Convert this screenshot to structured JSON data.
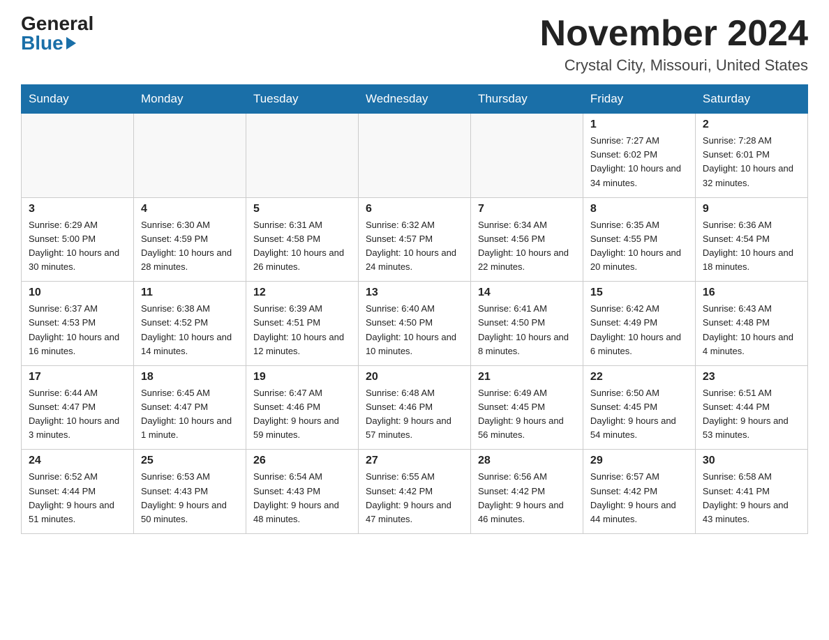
{
  "header": {
    "month_title": "November 2024",
    "location": "Crystal City, Missouri, United States",
    "logo_general": "General",
    "logo_blue": "Blue"
  },
  "weekdays": [
    "Sunday",
    "Monday",
    "Tuesday",
    "Wednesday",
    "Thursday",
    "Friday",
    "Saturday"
  ],
  "weeks": [
    [
      {
        "day": "",
        "info": ""
      },
      {
        "day": "",
        "info": ""
      },
      {
        "day": "",
        "info": ""
      },
      {
        "day": "",
        "info": ""
      },
      {
        "day": "",
        "info": ""
      },
      {
        "day": "1",
        "info": "Sunrise: 7:27 AM\nSunset: 6:02 PM\nDaylight: 10 hours and 34 minutes."
      },
      {
        "day": "2",
        "info": "Sunrise: 7:28 AM\nSunset: 6:01 PM\nDaylight: 10 hours and 32 minutes."
      }
    ],
    [
      {
        "day": "3",
        "info": "Sunrise: 6:29 AM\nSunset: 5:00 PM\nDaylight: 10 hours and 30 minutes."
      },
      {
        "day": "4",
        "info": "Sunrise: 6:30 AM\nSunset: 4:59 PM\nDaylight: 10 hours and 28 minutes."
      },
      {
        "day": "5",
        "info": "Sunrise: 6:31 AM\nSunset: 4:58 PM\nDaylight: 10 hours and 26 minutes."
      },
      {
        "day": "6",
        "info": "Sunrise: 6:32 AM\nSunset: 4:57 PM\nDaylight: 10 hours and 24 minutes."
      },
      {
        "day": "7",
        "info": "Sunrise: 6:34 AM\nSunset: 4:56 PM\nDaylight: 10 hours and 22 minutes."
      },
      {
        "day": "8",
        "info": "Sunrise: 6:35 AM\nSunset: 4:55 PM\nDaylight: 10 hours and 20 minutes."
      },
      {
        "day": "9",
        "info": "Sunrise: 6:36 AM\nSunset: 4:54 PM\nDaylight: 10 hours and 18 minutes."
      }
    ],
    [
      {
        "day": "10",
        "info": "Sunrise: 6:37 AM\nSunset: 4:53 PM\nDaylight: 10 hours and 16 minutes."
      },
      {
        "day": "11",
        "info": "Sunrise: 6:38 AM\nSunset: 4:52 PM\nDaylight: 10 hours and 14 minutes."
      },
      {
        "day": "12",
        "info": "Sunrise: 6:39 AM\nSunset: 4:51 PM\nDaylight: 10 hours and 12 minutes."
      },
      {
        "day": "13",
        "info": "Sunrise: 6:40 AM\nSunset: 4:50 PM\nDaylight: 10 hours and 10 minutes."
      },
      {
        "day": "14",
        "info": "Sunrise: 6:41 AM\nSunset: 4:50 PM\nDaylight: 10 hours and 8 minutes."
      },
      {
        "day": "15",
        "info": "Sunrise: 6:42 AM\nSunset: 4:49 PM\nDaylight: 10 hours and 6 minutes."
      },
      {
        "day": "16",
        "info": "Sunrise: 6:43 AM\nSunset: 4:48 PM\nDaylight: 10 hours and 4 minutes."
      }
    ],
    [
      {
        "day": "17",
        "info": "Sunrise: 6:44 AM\nSunset: 4:47 PM\nDaylight: 10 hours and 3 minutes."
      },
      {
        "day": "18",
        "info": "Sunrise: 6:45 AM\nSunset: 4:47 PM\nDaylight: 10 hours and 1 minute."
      },
      {
        "day": "19",
        "info": "Sunrise: 6:47 AM\nSunset: 4:46 PM\nDaylight: 9 hours and 59 minutes."
      },
      {
        "day": "20",
        "info": "Sunrise: 6:48 AM\nSunset: 4:46 PM\nDaylight: 9 hours and 57 minutes."
      },
      {
        "day": "21",
        "info": "Sunrise: 6:49 AM\nSunset: 4:45 PM\nDaylight: 9 hours and 56 minutes."
      },
      {
        "day": "22",
        "info": "Sunrise: 6:50 AM\nSunset: 4:45 PM\nDaylight: 9 hours and 54 minutes."
      },
      {
        "day": "23",
        "info": "Sunrise: 6:51 AM\nSunset: 4:44 PM\nDaylight: 9 hours and 53 minutes."
      }
    ],
    [
      {
        "day": "24",
        "info": "Sunrise: 6:52 AM\nSunset: 4:44 PM\nDaylight: 9 hours and 51 minutes."
      },
      {
        "day": "25",
        "info": "Sunrise: 6:53 AM\nSunset: 4:43 PM\nDaylight: 9 hours and 50 minutes."
      },
      {
        "day": "26",
        "info": "Sunrise: 6:54 AM\nSunset: 4:43 PM\nDaylight: 9 hours and 48 minutes."
      },
      {
        "day": "27",
        "info": "Sunrise: 6:55 AM\nSunset: 4:42 PM\nDaylight: 9 hours and 47 minutes."
      },
      {
        "day": "28",
        "info": "Sunrise: 6:56 AM\nSunset: 4:42 PM\nDaylight: 9 hours and 46 minutes."
      },
      {
        "day": "29",
        "info": "Sunrise: 6:57 AM\nSunset: 4:42 PM\nDaylight: 9 hours and 44 minutes."
      },
      {
        "day": "30",
        "info": "Sunrise: 6:58 AM\nSunset: 4:41 PM\nDaylight: 9 hours and 43 minutes."
      }
    ]
  ]
}
